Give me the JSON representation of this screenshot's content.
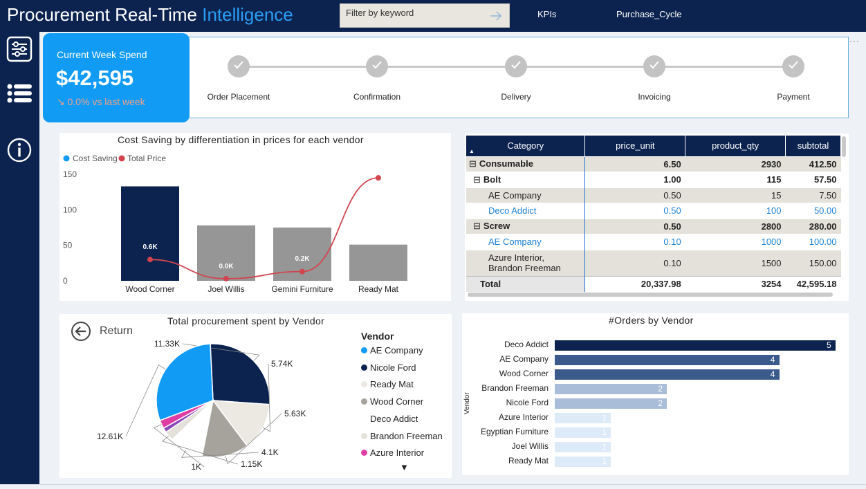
{
  "header": {
    "title_main": "Procurement Real-Time ",
    "title_accent": "Intelligence",
    "filter_placeholder": "Filter by keyword",
    "nav": [
      "KPIs",
      "Purchase_Cycle"
    ]
  },
  "sidebar": {
    "icons": [
      "filter-sliders-icon",
      "list-icon",
      "info-icon"
    ]
  },
  "kpi": {
    "title": "Current Week Spend",
    "value": "$42,595",
    "delta": "↘ 0.0% vs last week"
  },
  "stepper": {
    "steps": [
      "Order Placement",
      "Confirmation",
      "Delivery",
      "Invoicing",
      "Payment"
    ],
    "more": "···"
  },
  "combo_chart": {
    "title": "Cost Saving by differentiation in prices for each vendor",
    "legend": [
      "Cost Saving",
      "Total Price"
    ],
    "colors": {
      "bar_highlight": "#0c2350",
      "bar": "#969696",
      "line": "#d1454f",
      "legend_cost": "#119bf5"
    }
  },
  "chart_data": [
    {
      "type": "bar",
      "title": "Cost Saving by differentiation in prices for each vendor",
      "categories": [
        "Wood Corner",
        "Joel Willis",
        "Gemini Furniture",
        "Ready Mat"
      ],
      "series": [
        {
          "name": "Cost Saving",
          "values": [
            133,
            78,
            75,
            51
          ],
          "data_labels": [
            "0.6K",
            "0.0K",
            "0.2K",
            ""
          ]
        },
        {
          "name": "Total Price",
          "values": [
            30,
            3,
            13,
            145
          ]
        }
      ],
      "yticks": [
        0,
        50,
        100,
        150
      ],
      "ylim": [
        0,
        150
      ],
      "highlight_index": 0,
      "legend_position": "top-left"
    },
    {
      "type": "pie",
      "title": "Total procurement spent by Vendor",
      "legend_title": "Vendor",
      "slices": [
        {
          "name": "AE Company",
          "value": 12.61,
          "label": "12.61K",
          "color": "#119bf5"
        },
        {
          "name": "Nicole Ford",
          "value": 11.33,
          "label": "11.33K",
          "color": "#0c2350"
        },
        {
          "name": "Ready Mat",
          "value": 5.74,
          "label": "5.74K",
          "color": "#ece9e2"
        },
        {
          "name": "Wood Corner",
          "value": 5.63,
          "label": "5.63K",
          "color": "#a6a39d"
        },
        {
          "name": "Deco Addict",
          "value": 4.1,
          "label": "4.1K",
          "color": "#ffffff"
        },
        {
          "name": "Brandon Freeman",
          "value": 1.15,
          "label": "1.15K",
          "color": "#e4e1da"
        },
        {
          "name": "Azure Interior",
          "value": 1.0,
          "label": "1K",
          "color": "#de3ea3"
        },
        {
          "name": "",
          "value": 0.55,
          "label": "",
          "color": "#8b47b7"
        }
      ],
      "legend_position": "right"
    },
    {
      "type": "bar",
      "orientation": "horizontal",
      "title": "#Orders by Vendor",
      "ylabel": "Vendor",
      "categories": [
        "Deco Addict",
        "AE Company",
        "Wood Corner",
        "Brandon Freeman",
        "Nicole Ford",
        "Azure Interior",
        "Egyptian Furniture",
        "Joel Willis",
        "Ready Mat"
      ],
      "values": [
        5,
        4,
        4,
        2,
        2,
        1,
        1,
        1,
        1
      ],
      "xlim": [
        0,
        5
      ],
      "colors": [
        "#0c2350",
        "#3a5a8c",
        "#3a5a8c",
        "#a9bcd8",
        "#a9bcd8",
        "#ddebf8",
        "#ddebf8",
        "#ddebf8",
        "#ddebf8"
      ]
    }
  ],
  "matrix": {
    "headers": [
      "Category",
      "price_unit",
      "product_qty",
      "subtotal"
    ],
    "rows": [
      {
        "label": "Consumable",
        "toggle": "⊟",
        "indent": 0,
        "price": "6.50",
        "qty": "2930",
        "sub": "412.50",
        "style": "shade bold"
      },
      {
        "label": "Bolt",
        "toggle": "⊟",
        "indent": 1,
        "price": "1.00",
        "qty": "115",
        "sub": "57.50",
        "style": "bold"
      },
      {
        "label": "AE Company",
        "toggle": "",
        "indent": 2,
        "price": "0.50",
        "qty": "15",
        "sub": "7.50",
        "style": "shade"
      },
      {
        "label": "Deco Addict",
        "toggle": "",
        "indent": 2,
        "price": "0.50",
        "qty": "100",
        "sub": "50.00",
        "style": "link"
      },
      {
        "label": "Screw",
        "toggle": "⊟",
        "indent": 1,
        "price": "0.50",
        "qty": "2800",
        "sub": "280.00",
        "style": "shade bold"
      },
      {
        "label": "AE Company",
        "toggle": "",
        "indent": 2,
        "price": "0.10",
        "qty": "1000",
        "sub": "100.00",
        "style": "link"
      },
      {
        "label": "Azure Interior, Brandon Freeman",
        "toggle": "",
        "indent": 2,
        "price": "0.10",
        "qty": "1500",
        "sub": "150.00",
        "style": "shade tall"
      }
    ],
    "total": {
      "label": "Total",
      "price": "20,337.98",
      "qty": "3254",
      "sub": "42,595.18"
    }
  },
  "pie_panel": {
    "return_label": "Return",
    "legend_more": "▼"
  },
  "orders_chart": {
    "title": "#Orders by Vendor"
  }
}
